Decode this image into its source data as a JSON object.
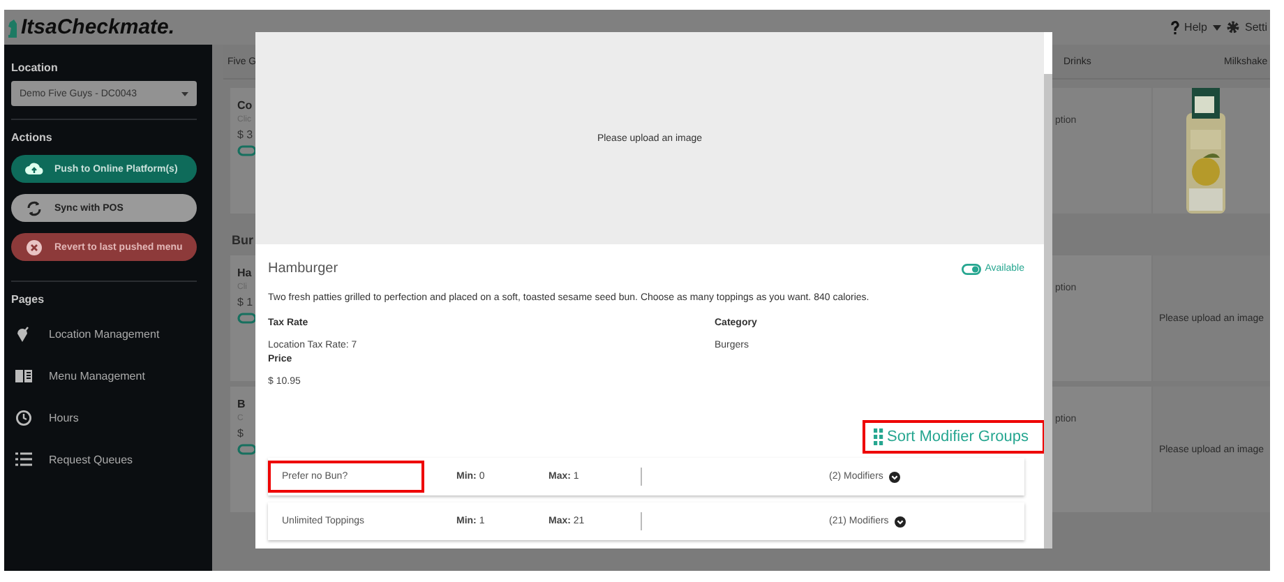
{
  "header": {
    "logo": "ItsaCheckmate.",
    "help": "Help",
    "settings": "Setti"
  },
  "sidebar": {
    "location_label": "Location",
    "location_value": "Demo Five Guys - DC0043",
    "actions_label": "Actions",
    "actions": [
      {
        "label": "Push to Online Platform(s)",
        "kind": "push"
      },
      {
        "label": "Sync with POS",
        "kind": "sync"
      },
      {
        "label": "Revert to last pushed menu",
        "kind": "revert"
      }
    ],
    "pages_label": "Pages",
    "pages": [
      {
        "label": "Location Management",
        "kind": "location"
      },
      {
        "label": "Menu Management",
        "kind": "menu"
      },
      {
        "label": "Hours",
        "kind": "hours"
      },
      {
        "label": "Request Queues",
        "kind": "queues"
      }
    ]
  },
  "menu": {
    "categories": [
      "Five G",
      "Drinks",
      "Milkshake"
    ],
    "rows": [
      {
        "card": {
          "title": "Co",
          "subtitle": "Clic",
          "price": "$ 3"
        },
        "side_text": "ption"
      },
      {
        "heading": "Bur",
        "card": {
          "title": "Ha",
          "subtitle": "Cli",
          "price": "$ 1"
        },
        "side_text": "ption",
        "image": {
          "kind": "placeholder",
          "text": "Please upload an image"
        }
      },
      {
        "card": {
          "title": "B",
          "subtitle": "C",
          "price": "$"
        },
        "side_text": "ption",
        "image": {
          "kind": "placeholder",
          "text": "Please upload an image"
        }
      }
    ]
  },
  "modal": {
    "image_placeholder": "Please upload an image",
    "title": "Hamburger",
    "available": {
      "label": "Available",
      "on": true
    },
    "description": "Two fresh patties grilled to perfection and placed on a soft, toasted sesame seed bun. Choose as many toppings as you want. 840 calories.",
    "tax_rate_label": "Tax Rate",
    "tax_rate": "Location Tax Rate: 7",
    "price_label": "Price",
    "price": "$ 10.95",
    "category_label": "Category",
    "category": "Burgers",
    "sort_button": {
      "label": "Sort Modifier Groups",
      "highlighted": true
    },
    "modifier_groups": [
      {
        "name": "Prefer no Bun?",
        "min": "**Min:** 0",
        "max": "**Max:** 1",
        "modifiers": "(2) Modifiers",
        "highlighted": true
      },
      {
        "name": "Unlimited Toppings",
        "min": "**Min:** 1",
        "max": "**Max:** 21",
        "modifiers": "(21) Modifiers",
        "highlighted": false
      }
    ]
  }
}
